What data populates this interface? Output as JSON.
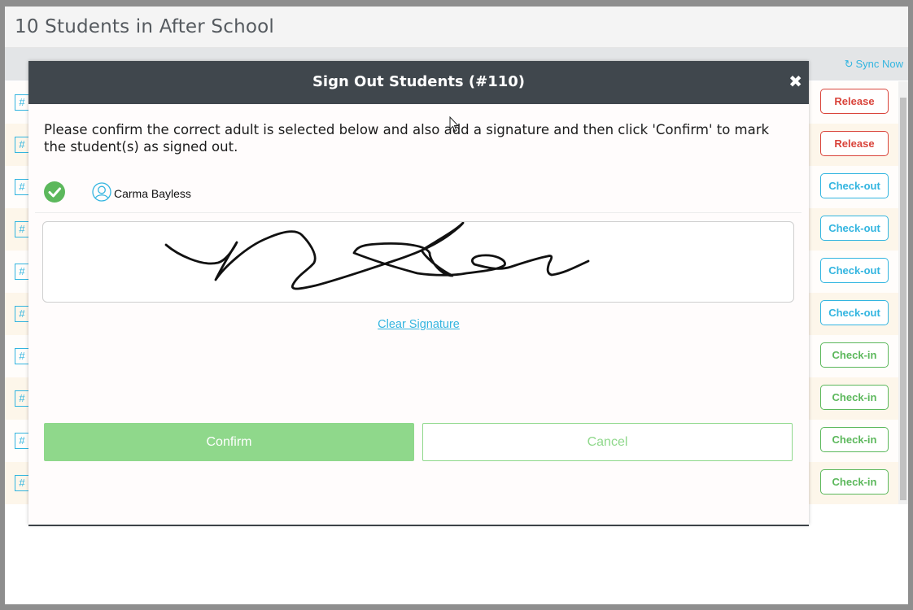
{
  "page": {
    "title": "10 Students in After School"
  },
  "toolbar": {
    "sync_label": "Sync Now",
    "sync_icon": "refresh-icon"
  },
  "rows": [
    {
      "tag": "#",
      "action": "Release",
      "status": "release"
    },
    {
      "tag": "#",
      "action": "Release",
      "status": "release"
    },
    {
      "tag": "#",
      "action": "Check-out",
      "status": "checkout"
    },
    {
      "tag": "#",
      "action": "Check-out",
      "status": "checkout"
    },
    {
      "tag": "#",
      "action": "Check-out",
      "status": "checkout"
    },
    {
      "tag": "#",
      "action": "Check-out",
      "status": "checkout"
    },
    {
      "tag": "#",
      "action": "Check-in",
      "status": "checkin"
    },
    {
      "tag": "#",
      "action": "Check-in",
      "status": "checkin"
    },
    {
      "tag": "#",
      "action": "Check-in",
      "status": "checkin"
    },
    {
      "tag": "#",
      "action": "Check-in",
      "status": "checkin"
    }
  ],
  "modal": {
    "title": "Sign Out Students (#110)",
    "close_icon": "close-icon",
    "instructions": "Please confirm the correct adult is selected below and also add a signature and then click 'Confirm' to mark the student(s) as signed out.",
    "adult": {
      "name": "Carma Bayless",
      "selected": true,
      "icons": [
        "check-circle-icon",
        "user-icon"
      ]
    },
    "clear_signature_label": "Clear Signature",
    "confirm_label": "Confirm",
    "cancel_label": "Cancel"
  },
  "colors": {
    "header_dark": "#40474d",
    "accent_blue": "#33b5e0",
    "release_red": "#d9443b",
    "checkin_green": "#5cb85c",
    "confirm_green": "#8fd88b"
  }
}
